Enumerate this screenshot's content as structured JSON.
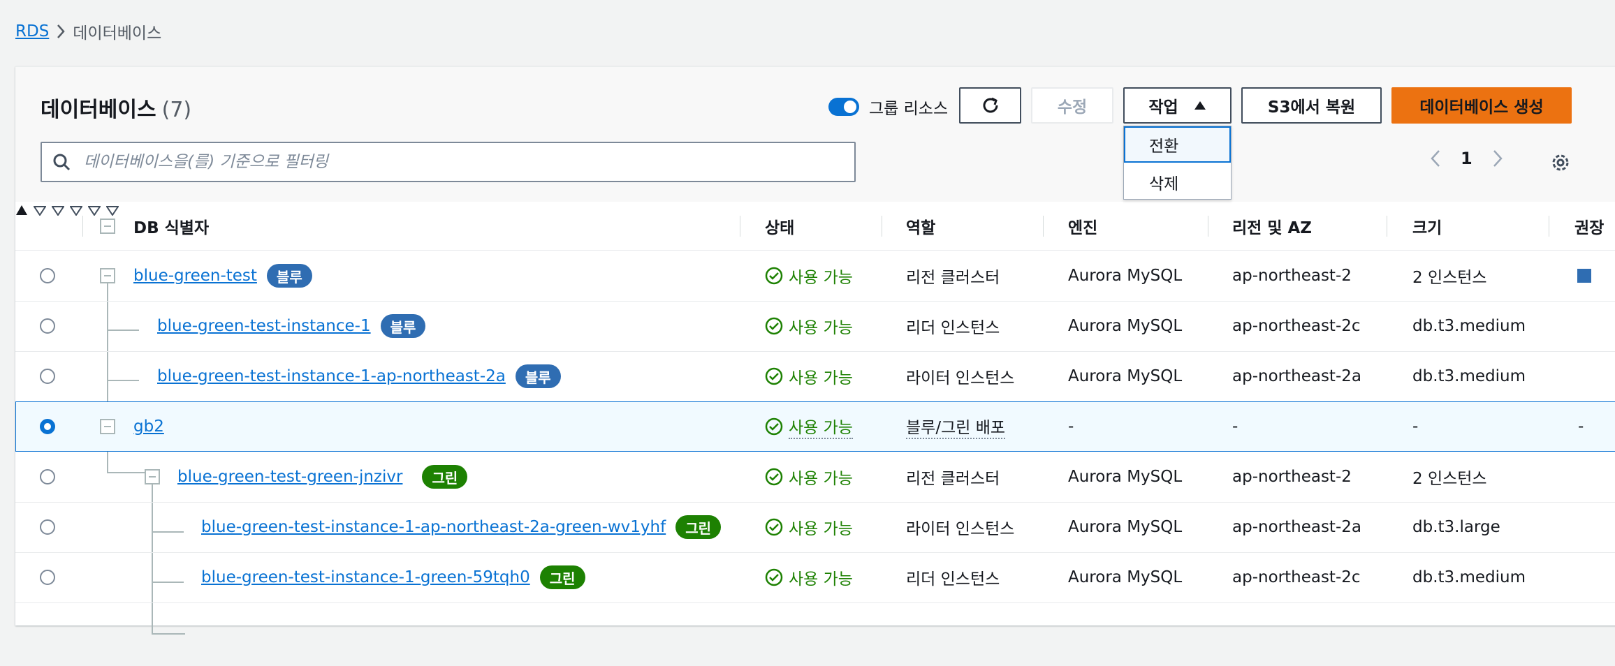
{
  "breadcrumb": {
    "root": "RDS",
    "current": "데이터베이스"
  },
  "header": {
    "title": "데이터베이스",
    "count": "(7)",
    "group_toggle_label": "그룹 리소스",
    "edit_label": "수정",
    "actions_label": "작업",
    "restore_label": "S3에서 복원",
    "create_label": "데이터베이스 생성"
  },
  "actions_menu": {
    "items": [
      "전환",
      "삭제"
    ]
  },
  "search": {
    "placeholder": "데이터베이스을(를) 기준으로 필터링"
  },
  "pagination": {
    "page": "1"
  },
  "table": {
    "columns": [
      "DB 식별자",
      "상태",
      "역할",
      "엔진",
      "리전 및 AZ",
      "크기",
      "권장"
    ],
    "rows": [
      {
        "id": "blue-green-test",
        "badge": "블루",
        "status": "사용 가능",
        "role": "리전 클러스터",
        "engine": "Aurora MySQL",
        "region": "ap-northeast-2",
        "size": "2 인스턴스"
      },
      {
        "id": "blue-green-test-instance-1",
        "badge": "블루",
        "status": "사용 가능",
        "role": "리더 인스턴스",
        "engine": "Aurora MySQL",
        "region": "ap-northeast-2c",
        "size": "db.t3.medium"
      },
      {
        "id": "blue-green-test-instance-1-ap-northeast-2a",
        "badge": "블루",
        "status": "사용 가능",
        "role": "라이터 인스턴스",
        "engine": "Aurora MySQL",
        "region": "ap-northeast-2a",
        "size": "db.t3.medium"
      },
      {
        "id": "gb2",
        "badge": "",
        "status": "사용 가능",
        "role": "블루/그린 배포",
        "engine": "-",
        "region": "-",
        "size": "-",
        "rec": "-"
      },
      {
        "id": "blue-green-test-green-jnzivr",
        "badge": "그린",
        "status": "사용 가능",
        "role": "리전 클러스터",
        "engine": "Aurora MySQL",
        "region": "ap-northeast-2",
        "size": "2 인스턴스"
      },
      {
        "id": "blue-green-test-instance-1-ap-northeast-2a-green-wv1yhf",
        "badge": "그린",
        "status": "사용 가능",
        "role": "라이터 인스턴스",
        "engine": "Aurora MySQL",
        "region": "ap-northeast-2a",
        "size": "db.t3.large"
      },
      {
        "id": "blue-green-test-instance-1-green-59tqh0",
        "badge": "그린",
        "status": "사용 가능",
        "role": "리더 인스턴스",
        "engine": "Aurora MySQL",
        "region": "ap-northeast-2c",
        "size": "db.t3.medium"
      }
    ]
  }
}
